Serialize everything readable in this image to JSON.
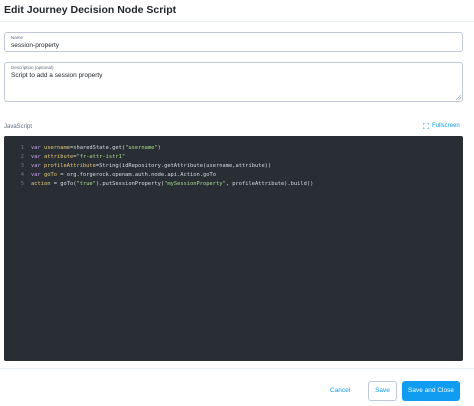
{
  "modal": {
    "title": "Edit Journey Decision Node Script"
  },
  "form": {
    "name_label": "Name",
    "name_value": "session-property",
    "description_label": "Description (optional)",
    "description_value": "Script to add a session property",
    "script_label": "JavaScript",
    "fullscreen_label": "Fullscreen"
  },
  "editor": {
    "lines": [
      {
        "num": "1",
        "tokens": [
          {
            "t": "var ",
            "c": "kw"
          },
          {
            "t": "username",
            "c": "id"
          },
          {
            "t": "=sharedState.get(",
            "c": "ptxt"
          },
          {
            "t": "\"username\"",
            "c": "str"
          },
          {
            "t": ")",
            "c": "ptxt"
          }
        ]
      },
      {
        "num": "2",
        "tokens": [
          {
            "t": "var ",
            "c": "kw"
          },
          {
            "t": "attribute",
            "c": "id"
          },
          {
            "t": "=",
            "c": "op"
          },
          {
            "t": "\"fr-attr-istr1\"",
            "c": "str"
          }
        ]
      },
      {
        "num": "3",
        "tokens": [
          {
            "t": "var ",
            "c": "kw"
          },
          {
            "t": "profileAttribute",
            "c": "id"
          },
          {
            "t": "=String(idRepository.getAttribute(username,attribute))",
            "c": "ptxt"
          }
        ]
      },
      {
        "num": "4",
        "tokens": [
          {
            "t": "var ",
            "c": "kw"
          },
          {
            "t": "goTo",
            "c": "id"
          },
          {
            "t": " = org.forgerock.openam.auth.node.api.Action.goTo",
            "c": "ptxt"
          }
        ]
      },
      {
        "num": "5",
        "tokens": [
          {
            "t": "action",
            "c": "id"
          },
          {
            "t": " = goTo(",
            "c": "ptxt"
          },
          {
            "t": "\"true\"",
            "c": "str"
          },
          {
            "t": ").putSessionProperty(",
            "c": "ptxt"
          },
          {
            "t": "\"mySessionProperty\"",
            "c": "str"
          },
          {
            "t": ", profileAttribute).build()",
            "c": "ptxt"
          }
        ]
      }
    ]
  },
  "footer": {
    "cancel_label": "Cancel",
    "save_label": "Save",
    "save_close_label": "Save and Close"
  },
  "colors": {
    "accent": "#109cf1",
    "editor_bg": "#292e34"
  }
}
